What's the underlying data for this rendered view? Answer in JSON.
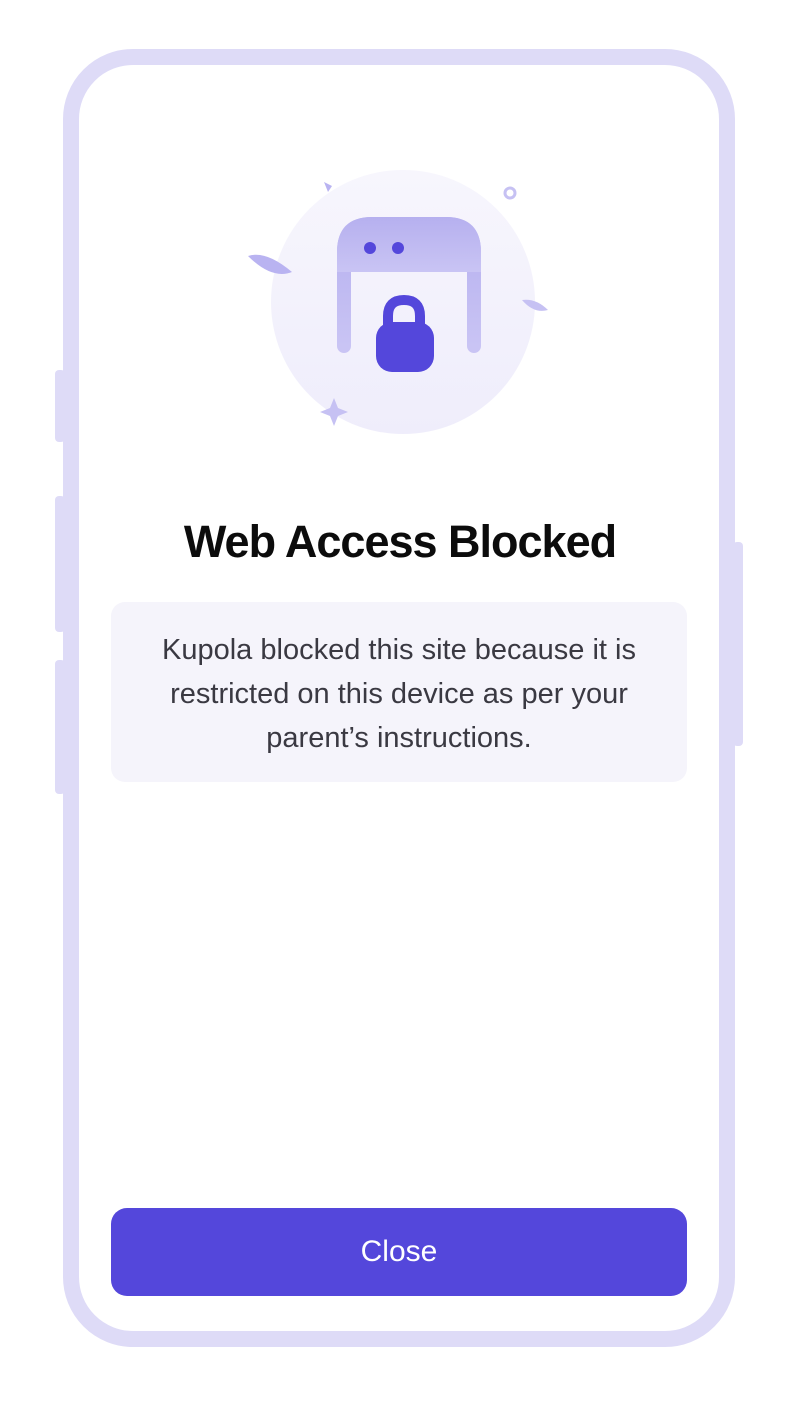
{
  "screen": {
    "title": "Web Access Blocked",
    "message": "Kupola blocked this site because it is restricted on this device as per your parent’s instructions.",
    "close_label": "Close"
  },
  "illustration": {
    "icon": "locked-browser-icon"
  },
  "colors": {
    "accent": "#5447DB",
    "frame": "#DEDBF7",
    "card_background": "#F5F4FB",
    "title_text": "#0C0C0C",
    "body_text": "#3A3942"
  }
}
